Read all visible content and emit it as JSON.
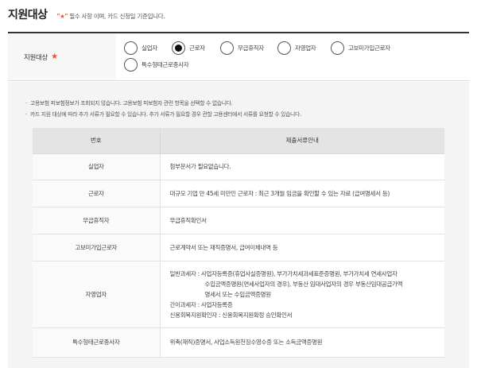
{
  "header": {
    "title": "지원대상",
    "note_star": "\"★\"",
    "note_text": "필수 사항 이며, 카드 신청일 기준입니다."
  },
  "form": {
    "label": "지원대상",
    "required_mark": "★",
    "options": [
      {
        "label": "실업자",
        "selected": false
      },
      {
        "label": "근로자",
        "selected": true
      },
      {
        "label": "무급휴직자",
        "selected": false
      },
      {
        "label": "자영업자",
        "selected": false
      },
      {
        "label": "고보미가입근로자",
        "selected": false
      },
      {
        "label": "특수형태근로종사자",
        "selected": false
      }
    ]
  },
  "notes": [
    "고용보험 피보험정보가 조회되지 않습니다. 고용보험 피보험자 관련 항목을 선택할 수 없습니다.",
    "카드 지원 대상에 따라 추가 서류가 필요할 수 있습니다. 추가 서류가 필요할 경우 관할 고용센터에서 서류를 요청할 수 있습니다."
  ],
  "table": {
    "headers": [
      "번호",
      "제출서류안내"
    ],
    "rows": [
      {
        "type": "실업자",
        "lines": [
          "첨부문서가 필요없습니다."
        ]
      },
      {
        "type": "근로자",
        "lines": [
          "대규모 기업 만 45세 미만인 근로자 : 최근 3개월 임금을 확인할 수 있는 자료 (급여명세서 등)"
        ]
      },
      {
        "type": "무급휴직자",
        "lines": [
          "무급휴직확인서"
        ]
      },
      {
        "type": "고보미가입근로자",
        "lines": [
          "근로계약서 또는 재직증명서, 급여이체내역 등"
        ]
      },
      {
        "type": "자영업자",
        "lines": [
          "일반과세자 : 사업자등록증(휴업사실증명원), 부가가치세과세표준증명원, 부가가치세 연세사업자",
          "수입금액증명원(면세사업자의 경우), 부동산 임대사업자의 경우 부동산임대공급가액",
          "명세서 또는 수입금액증명원",
          "간이과세자 : 사업자등록증",
          "신용회복지원확인자 : 신용회복지원확정 승인확인서"
        ]
      },
      {
        "type": "특수형태근로종사자",
        "lines": [
          "위촉(재직)증명서, 사업소득원천징수영수증 또는 소득금액증명원"
        ]
      }
    ]
  }
}
